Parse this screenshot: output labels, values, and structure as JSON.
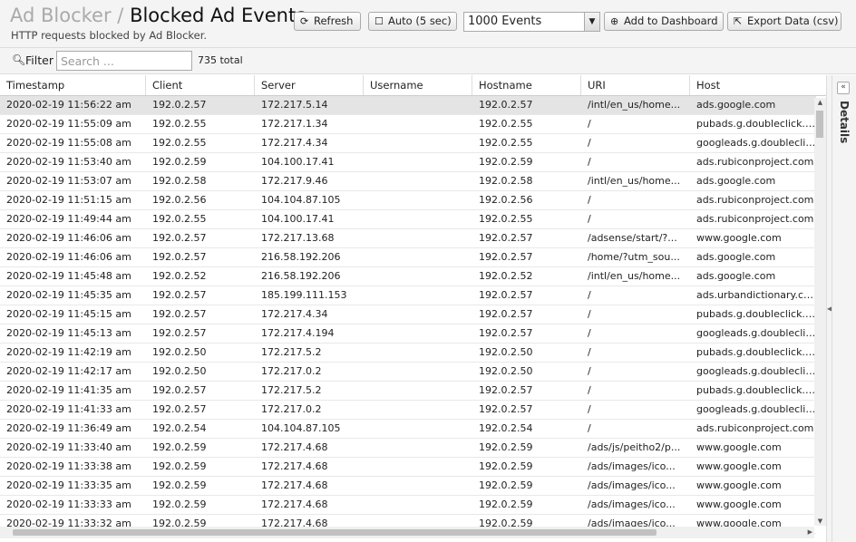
{
  "header": {
    "breadcrumb": "Ad Blocker",
    "separator": "/",
    "title": "Blocked Ad Events",
    "subtitle": "HTTP requests blocked by Ad Blocker.",
    "buttons": {
      "refresh": "Refresh",
      "auto": "Auto (5 sec)",
      "add_dashboard": "Add to Dashboard",
      "export": "Export Data (csv)"
    },
    "events_select": "1000 Events"
  },
  "filter": {
    "label": "Filter",
    "placeholder": "Search ...",
    "total": "735 total"
  },
  "table": {
    "columns": [
      "Timestamp",
      "Client",
      "Server",
      "Username",
      "Hostname",
      "URI",
      "Host"
    ],
    "rows": [
      [
        "2020-02-19 11:56:22 am",
        "192.0.2.57",
        "172.217.5.14",
        "",
        "192.0.2.57",
        "/intl/en_us/home...",
        "ads.google.com"
      ],
      [
        "2020-02-19 11:55:09 am",
        "192.0.2.55",
        "172.217.1.34",
        "",
        "192.0.2.55",
        "/",
        "pubads.g.doubleclick.net"
      ],
      [
        "2020-02-19 11:55:08 am",
        "192.0.2.55",
        "172.217.4.34",
        "",
        "192.0.2.55",
        "/",
        "googleads.g.doubleclick.net"
      ],
      [
        "2020-02-19 11:53:40 am",
        "192.0.2.59",
        "104.100.17.41",
        "",
        "192.0.2.59",
        "/",
        "ads.rubiconproject.com"
      ],
      [
        "2020-02-19 11:53:07 am",
        "192.0.2.58",
        "172.217.9.46",
        "",
        "192.0.2.58",
        "/intl/en_us/home...",
        "ads.google.com"
      ],
      [
        "2020-02-19 11:51:15 am",
        "192.0.2.56",
        "104.104.87.105",
        "",
        "192.0.2.56",
        "/",
        "ads.rubiconproject.com"
      ],
      [
        "2020-02-19 11:49:44 am",
        "192.0.2.55",
        "104.100.17.41",
        "",
        "192.0.2.55",
        "/",
        "ads.rubiconproject.com"
      ],
      [
        "2020-02-19 11:46:06 am",
        "192.0.2.57",
        "172.217.13.68",
        "",
        "192.0.2.57",
        "/adsense/start/?...",
        "www.google.com"
      ],
      [
        "2020-02-19 11:46:06 am",
        "192.0.2.57",
        "216.58.192.206",
        "",
        "192.0.2.57",
        "/home/?utm_sou...",
        "ads.google.com"
      ],
      [
        "2020-02-19 11:45:48 am",
        "192.0.2.52",
        "216.58.192.206",
        "",
        "192.0.2.52",
        "/intl/en_us/home...",
        "ads.google.com"
      ],
      [
        "2020-02-19 11:45:35 am",
        "192.0.2.57",
        "185.199.111.153",
        "",
        "192.0.2.57",
        "/",
        "ads.urbandictionary.com"
      ],
      [
        "2020-02-19 11:45:15 am",
        "192.0.2.57",
        "172.217.4.34",
        "",
        "192.0.2.57",
        "/",
        "pubads.g.doubleclick.net"
      ],
      [
        "2020-02-19 11:45:13 am",
        "192.0.2.57",
        "172.217.4.194",
        "",
        "192.0.2.57",
        "/",
        "googleads.g.doubleclick.net"
      ],
      [
        "2020-02-19 11:42:19 am",
        "192.0.2.50",
        "172.217.5.2",
        "",
        "192.0.2.50",
        "/",
        "pubads.g.doubleclick.net"
      ],
      [
        "2020-02-19 11:42:17 am",
        "192.0.2.50",
        "172.217.0.2",
        "",
        "192.0.2.50",
        "/",
        "googleads.g.doubleclick.net"
      ],
      [
        "2020-02-19 11:41:35 am",
        "192.0.2.57",
        "172.217.5.2",
        "",
        "192.0.2.57",
        "/",
        "pubads.g.doubleclick.net"
      ],
      [
        "2020-02-19 11:41:33 am",
        "192.0.2.57",
        "172.217.0.2",
        "",
        "192.0.2.57",
        "/",
        "googleads.g.doubleclick.net"
      ],
      [
        "2020-02-19 11:36:49 am",
        "192.0.2.54",
        "104.104.87.105",
        "",
        "192.0.2.54",
        "/",
        "ads.rubiconproject.com"
      ],
      [
        "2020-02-19 11:33:40 am",
        "192.0.2.59",
        "172.217.4.68",
        "",
        "192.0.2.59",
        "/ads/js/peitho2/p...",
        "www.google.com"
      ],
      [
        "2020-02-19 11:33:38 am",
        "192.0.2.59",
        "172.217.4.68",
        "",
        "192.0.2.59",
        "/ads/images/ico...",
        "www.google.com"
      ],
      [
        "2020-02-19 11:33:35 am",
        "192.0.2.59",
        "172.217.4.68",
        "",
        "192.0.2.59",
        "/ads/images/ico...",
        "www.google.com"
      ],
      [
        "2020-02-19 11:33:33 am",
        "192.0.2.59",
        "172.217.4.68",
        "",
        "192.0.2.59",
        "/ads/images/ico...",
        "www.google.com"
      ],
      [
        "2020-02-19 11:33:32 am",
        "192.0.2.59",
        "172.217.4.68",
        "",
        "192.0.2.59",
        "/ads/images/ico...",
        "www.google.com"
      ]
    ]
  },
  "details_panel": {
    "label": "Details"
  },
  "icons": {
    "refresh": "refresh-icon",
    "auto": "checkbox-icon",
    "add": "plus-circle-icon",
    "export": "export-icon",
    "filter": "search-icon",
    "collapse": "double-chevron-left-icon"
  },
  "colors": {
    "selected_row": "#e4e4e4",
    "breadcrumb": "#aaaaaa"
  }
}
